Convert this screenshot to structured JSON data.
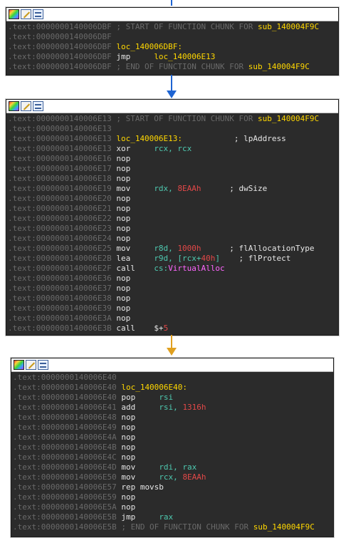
{
  "colors": {
    "block_bg": "#2b2b2b",
    "address": "#6a6a6a",
    "label": "#ffd700",
    "register": "#4ec9b0",
    "number": "#e24848",
    "import": "#ff66ff",
    "arrow_blue": "#1e64d2",
    "arrow_orange": "#e0a020"
  },
  "toolbar_icons": [
    "palette-icon",
    "edit-icon",
    "graph-icon"
  ],
  "blocks": [
    {
      "lines": [
        {
          "addr": ".text:0000000140006DBF",
          "parts": [
            {
              "t": " ; START OF FUNCTION CHUNK FOR ",
              "c": "cmt"
            },
            {
              "t": "sub_140004F9C",
              "c": "sub"
            }
          ]
        },
        {
          "addr": ".text:0000000140006DBF",
          "parts": []
        },
        {
          "addr": ".text:0000000140006DBF",
          "parts": [
            {
              "t": " loc_140006DBF:",
              "c": "lbl"
            }
          ]
        },
        {
          "addr": ".text:0000000140006DBF",
          "parts": [
            {
              "t": " jmp     ",
              "c": "mn"
            },
            {
              "t": "loc_140006E13",
              "c": "lbl"
            }
          ]
        },
        {
          "addr": ".text:0000000140006DBF",
          "parts": [
            {
              "t": " ; END OF FUNCTION CHUNK FOR ",
              "c": "cmt"
            },
            {
              "t": "sub_140004F9C",
              "c": "sub"
            }
          ]
        }
      ]
    },
    {
      "lines": [
        {
          "addr": ".text:0000000140006E13",
          "parts": [
            {
              "t": " ; START OF FUNCTION CHUNK FOR ",
              "c": "cmt"
            },
            {
              "t": "sub_140004F9C",
              "c": "sub"
            }
          ]
        },
        {
          "addr": ".text:0000000140006E13",
          "parts": []
        },
        {
          "addr": ".text:0000000140006E13",
          "parts": [
            {
              "t": " loc_140006E13:",
              "c": "lbl"
            },
            {
              "t": "           ; lpAddress",
              "c": "pcmt"
            }
          ]
        },
        {
          "addr": ".text:0000000140006E13",
          "parts": [
            {
              "t": " xor     ",
              "c": "mn"
            },
            {
              "t": "rcx, rcx",
              "c": "reg"
            }
          ]
        },
        {
          "addr": ".text:0000000140006E16",
          "parts": [
            {
              "t": " nop",
              "c": "mn"
            }
          ]
        },
        {
          "addr": ".text:0000000140006E17",
          "parts": [
            {
              "t": " nop",
              "c": "mn"
            }
          ]
        },
        {
          "addr": ".text:0000000140006E18",
          "parts": [
            {
              "t": " nop",
              "c": "mn"
            }
          ]
        },
        {
          "addr": ".text:0000000140006E19",
          "parts": [
            {
              "t": " mov     ",
              "c": "mn"
            },
            {
              "t": "rdx, ",
              "c": "reg"
            },
            {
              "t": "8EAAh",
              "c": "num"
            },
            {
              "t": "      ; dwSize",
              "c": "pcmt"
            }
          ]
        },
        {
          "addr": ".text:0000000140006E20",
          "parts": [
            {
              "t": " nop",
              "c": "mn"
            }
          ]
        },
        {
          "addr": ".text:0000000140006E21",
          "parts": [
            {
              "t": " nop",
              "c": "mn"
            }
          ]
        },
        {
          "addr": ".text:0000000140006E22",
          "parts": [
            {
              "t": " nop",
              "c": "mn"
            }
          ]
        },
        {
          "addr": ".text:0000000140006E23",
          "parts": [
            {
              "t": " nop",
              "c": "mn"
            }
          ]
        },
        {
          "addr": ".text:0000000140006E24",
          "parts": [
            {
              "t": " nop",
              "c": "mn"
            }
          ]
        },
        {
          "addr": ".text:0000000140006E25",
          "parts": [
            {
              "t": " mov     ",
              "c": "mn"
            },
            {
              "t": "r8d, ",
              "c": "reg"
            },
            {
              "t": "1000h",
              "c": "num"
            },
            {
              "t": "      ; flAllocationType",
              "c": "pcmt"
            }
          ]
        },
        {
          "addr": ".text:0000000140006E2B",
          "parts": [
            {
              "t": " lea     ",
              "c": "mn"
            },
            {
              "t": "r9d, [rcx+",
              "c": "reg"
            },
            {
              "t": "40h",
              "c": "num"
            },
            {
              "t": "]",
              "c": "reg"
            },
            {
              "t": "    ; flProtect",
              "c": "pcmt"
            }
          ]
        },
        {
          "addr": ".text:0000000140006E2F",
          "parts": [
            {
              "t": " call    ",
              "c": "mn"
            },
            {
              "t": "cs:",
              "c": "reg"
            },
            {
              "t": "VirtualAlloc",
              "c": "imp"
            }
          ]
        },
        {
          "addr": ".text:0000000140006E36",
          "parts": [
            {
              "t": " nop",
              "c": "mn"
            }
          ]
        },
        {
          "addr": ".text:0000000140006E37",
          "parts": [
            {
              "t": " nop",
              "c": "mn"
            }
          ]
        },
        {
          "addr": ".text:0000000140006E38",
          "parts": [
            {
              "t": " nop",
              "c": "mn"
            }
          ]
        },
        {
          "addr": ".text:0000000140006E39",
          "parts": [
            {
              "t": " nop",
              "c": "mn"
            }
          ]
        },
        {
          "addr": ".text:0000000140006E3A",
          "parts": [
            {
              "t": " nop",
              "c": "mn"
            }
          ]
        },
        {
          "addr": ".text:0000000140006E3B",
          "parts": [
            {
              "t": " call    ",
              "c": "mn"
            },
            {
              "t": "$+",
              "c": "mn"
            },
            {
              "t": "5",
              "c": "num"
            }
          ]
        }
      ]
    },
    {
      "lines": [
        {
          "addr": ".text:0000000140006E40",
          "parts": []
        },
        {
          "addr": ".text:0000000140006E40",
          "parts": [
            {
              "t": " loc_140006E40:",
              "c": "lbl"
            }
          ]
        },
        {
          "addr": ".text:0000000140006E40",
          "parts": [
            {
              "t": " pop     ",
              "c": "mn"
            },
            {
              "t": "rsi",
              "c": "reg"
            }
          ]
        },
        {
          "addr": ".text:0000000140006E41",
          "parts": [
            {
              "t": " add     ",
              "c": "mn"
            },
            {
              "t": "rsi, ",
              "c": "reg"
            },
            {
              "t": "1316h",
              "c": "num"
            }
          ]
        },
        {
          "addr": ".text:0000000140006E48",
          "parts": [
            {
              "t": " nop",
              "c": "mn"
            }
          ]
        },
        {
          "addr": ".text:0000000140006E49",
          "parts": [
            {
              "t": " nop",
              "c": "mn"
            }
          ]
        },
        {
          "addr": ".text:0000000140006E4A",
          "parts": [
            {
              "t": " nop",
              "c": "mn"
            }
          ]
        },
        {
          "addr": ".text:0000000140006E4B",
          "parts": [
            {
              "t": " nop",
              "c": "mn"
            }
          ]
        },
        {
          "addr": ".text:0000000140006E4C",
          "parts": [
            {
              "t": " nop",
              "c": "mn"
            }
          ]
        },
        {
          "addr": ".text:0000000140006E4D",
          "parts": [
            {
              "t": " mov     ",
              "c": "mn"
            },
            {
              "t": "rdi, rax",
              "c": "reg"
            }
          ]
        },
        {
          "addr": ".text:0000000140006E50",
          "parts": [
            {
              "t": " mov     ",
              "c": "mn"
            },
            {
              "t": "rcx, ",
              "c": "reg"
            },
            {
              "t": "8EAAh",
              "c": "num"
            }
          ]
        },
        {
          "addr": ".text:0000000140006E57",
          "parts": [
            {
              "t": " rep movsb",
              "c": "mn"
            }
          ]
        },
        {
          "addr": ".text:0000000140006E59",
          "parts": [
            {
              "t": " nop",
              "c": "mn"
            }
          ]
        },
        {
          "addr": ".text:0000000140006E5A",
          "parts": [
            {
              "t": " nop",
              "c": "mn"
            }
          ]
        },
        {
          "addr": ".text:0000000140006E5B",
          "parts": [
            {
              "t": " jmp     ",
              "c": "mn"
            },
            {
              "t": "rax",
              "c": "reg"
            }
          ]
        },
        {
          "addr": ".text:0000000140006E5B",
          "parts": [
            {
              "t": " ; END OF FUNCTION CHUNK FOR ",
              "c": "cmt"
            },
            {
              "t": "sub_140004F9C",
              "c": "sub"
            }
          ]
        }
      ]
    }
  ]
}
